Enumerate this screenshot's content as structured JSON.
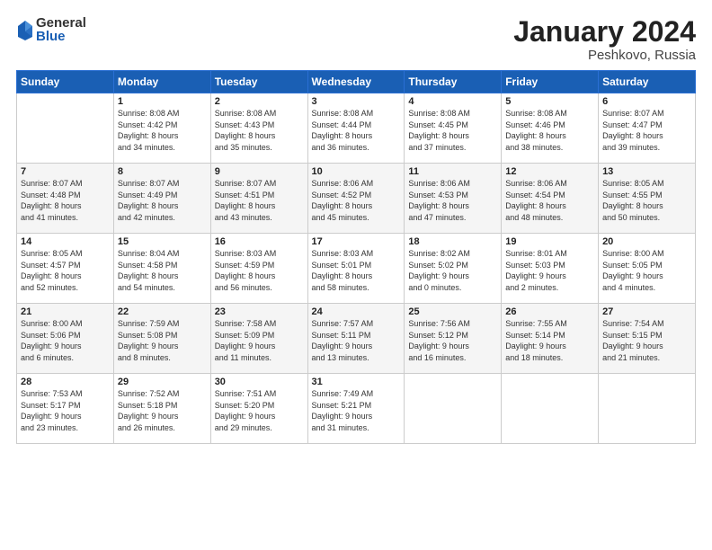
{
  "logo": {
    "general": "General",
    "blue": "Blue"
  },
  "title": "January 2024",
  "location": "Peshkovo, Russia",
  "days_header": [
    "Sunday",
    "Monday",
    "Tuesday",
    "Wednesday",
    "Thursday",
    "Friday",
    "Saturday"
  ],
  "weeks": [
    [
      {
        "day": "",
        "info": ""
      },
      {
        "day": "1",
        "info": "Sunrise: 8:08 AM\nSunset: 4:42 PM\nDaylight: 8 hours\nand 34 minutes."
      },
      {
        "day": "2",
        "info": "Sunrise: 8:08 AM\nSunset: 4:43 PM\nDaylight: 8 hours\nand 35 minutes."
      },
      {
        "day": "3",
        "info": "Sunrise: 8:08 AM\nSunset: 4:44 PM\nDaylight: 8 hours\nand 36 minutes."
      },
      {
        "day": "4",
        "info": "Sunrise: 8:08 AM\nSunset: 4:45 PM\nDaylight: 8 hours\nand 37 minutes."
      },
      {
        "day": "5",
        "info": "Sunrise: 8:08 AM\nSunset: 4:46 PM\nDaylight: 8 hours\nand 38 minutes."
      },
      {
        "day": "6",
        "info": "Sunrise: 8:07 AM\nSunset: 4:47 PM\nDaylight: 8 hours\nand 39 minutes."
      }
    ],
    [
      {
        "day": "7",
        "info": "Sunrise: 8:07 AM\nSunset: 4:48 PM\nDaylight: 8 hours\nand 41 minutes."
      },
      {
        "day": "8",
        "info": "Sunrise: 8:07 AM\nSunset: 4:49 PM\nDaylight: 8 hours\nand 42 minutes."
      },
      {
        "day": "9",
        "info": "Sunrise: 8:07 AM\nSunset: 4:51 PM\nDaylight: 8 hours\nand 43 minutes."
      },
      {
        "day": "10",
        "info": "Sunrise: 8:06 AM\nSunset: 4:52 PM\nDaylight: 8 hours\nand 45 minutes."
      },
      {
        "day": "11",
        "info": "Sunrise: 8:06 AM\nSunset: 4:53 PM\nDaylight: 8 hours\nand 47 minutes."
      },
      {
        "day": "12",
        "info": "Sunrise: 8:06 AM\nSunset: 4:54 PM\nDaylight: 8 hours\nand 48 minutes."
      },
      {
        "day": "13",
        "info": "Sunrise: 8:05 AM\nSunset: 4:55 PM\nDaylight: 8 hours\nand 50 minutes."
      }
    ],
    [
      {
        "day": "14",
        "info": "Sunrise: 8:05 AM\nSunset: 4:57 PM\nDaylight: 8 hours\nand 52 minutes."
      },
      {
        "day": "15",
        "info": "Sunrise: 8:04 AM\nSunset: 4:58 PM\nDaylight: 8 hours\nand 54 minutes."
      },
      {
        "day": "16",
        "info": "Sunrise: 8:03 AM\nSunset: 4:59 PM\nDaylight: 8 hours\nand 56 minutes."
      },
      {
        "day": "17",
        "info": "Sunrise: 8:03 AM\nSunset: 5:01 PM\nDaylight: 8 hours\nand 58 minutes."
      },
      {
        "day": "18",
        "info": "Sunrise: 8:02 AM\nSunset: 5:02 PM\nDaylight: 9 hours\nand 0 minutes."
      },
      {
        "day": "19",
        "info": "Sunrise: 8:01 AM\nSunset: 5:03 PM\nDaylight: 9 hours\nand 2 minutes."
      },
      {
        "day": "20",
        "info": "Sunrise: 8:00 AM\nSunset: 5:05 PM\nDaylight: 9 hours\nand 4 minutes."
      }
    ],
    [
      {
        "day": "21",
        "info": "Sunrise: 8:00 AM\nSunset: 5:06 PM\nDaylight: 9 hours\nand 6 minutes."
      },
      {
        "day": "22",
        "info": "Sunrise: 7:59 AM\nSunset: 5:08 PM\nDaylight: 9 hours\nand 8 minutes."
      },
      {
        "day": "23",
        "info": "Sunrise: 7:58 AM\nSunset: 5:09 PM\nDaylight: 9 hours\nand 11 minutes."
      },
      {
        "day": "24",
        "info": "Sunrise: 7:57 AM\nSunset: 5:11 PM\nDaylight: 9 hours\nand 13 minutes."
      },
      {
        "day": "25",
        "info": "Sunrise: 7:56 AM\nSunset: 5:12 PM\nDaylight: 9 hours\nand 16 minutes."
      },
      {
        "day": "26",
        "info": "Sunrise: 7:55 AM\nSunset: 5:14 PM\nDaylight: 9 hours\nand 18 minutes."
      },
      {
        "day": "27",
        "info": "Sunrise: 7:54 AM\nSunset: 5:15 PM\nDaylight: 9 hours\nand 21 minutes."
      }
    ],
    [
      {
        "day": "28",
        "info": "Sunrise: 7:53 AM\nSunset: 5:17 PM\nDaylight: 9 hours\nand 23 minutes."
      },
      {
        "day": "29",
        "info": "Sunrise: 7:52 AM\nSunset: 5:18 PM\nDaylight: 9 hours\nand 26 minutes."
      },
      {
        "day": "30",
        "info": "Sunrise: 7:51 AM\nSunset: 5:20 PM\nDaylight: 9 hours\nand 29 minutes."
      },
      {
        "day": "31",
        "info": "Sunrise: 7:49 AM\nSunset: 5:21 PM\nDaylight: 9 hours\nand 31 minutes."
      },
      {
        "day": "",
        "info": ""
      },
      {
        "day": "",
        "info": ""
      },
      {
        "day": "",
        "info": ""
      }
    ]
  ]
}
